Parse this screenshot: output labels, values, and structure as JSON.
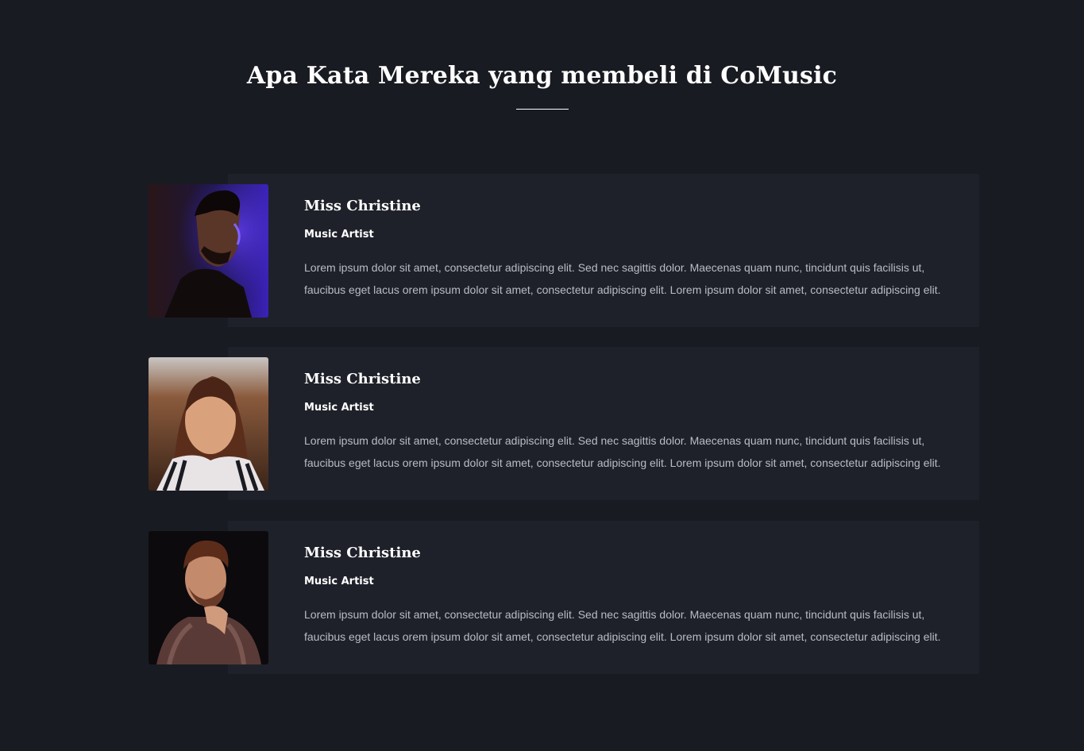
{
  "section": {
    "title": "Apa Kata Mereka yang membeli di CoMusic"
  },
  "testimonials": [
    {
      "name": "Miss Christine",
      "role": "Music Artist",
      "quote": "Lorem ipsum dolor sit amet, consectetur adipiscing elit. Sed nec sagittis dolor. Maecenas quam nunc, tincidunt quis facilisis ut, faucibus eget lacus orem ipsum dolor sit amet, consectetur adipiscing elit. Lorem ipsum dolor sit amet, consectetur adipiscing elit."
    },
    {
      "name": "Miss Christine",
      "role": "Music Artist",
      "quote": "Lorem ipsum dolor sit amet, consectetur adipiscing elit. Sed nec sagittis dolor. Maecenas quam nunc, tincidunt quis facilisis ut, faucibus eget lacus orem ipsum dolor sit amet, consectetur adipiscing elit. Lorem ipsum dolor sit amet, consectetur adipiscing elit."
    },
    {
      "name": "Miss Christine",
      "role": "Music Artist",
      "quote": "Lorem ipsum dolor sit amet, consectetur adipiscing elit. Sed nec sagittis dolor. Maecenas quam nunc, tincidunt quis facilisis ut, faucibus eget lacus orem ipsum dolor sit amet, consectetur adipiscing elit. Lorem ipsum dolor sit amet, consectetur adipiscing elit."
    }
  ],
  "colors": {
    "page_background": "#191b22",
    "card_background": "#1f212a",
    "heading_text": "#ffffff",
    "body_text": "#b9bcc5"
  }
}
